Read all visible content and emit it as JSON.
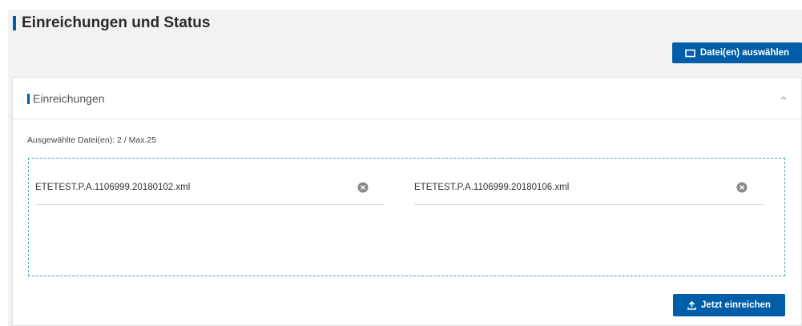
{
  "page": {
    "title": "Einreichungen und Status"
  },
  "toolbar": {
    "select_files_label": "Datei(en) auswählen",
    "select_files_icon": "folder-icon"
  },
  "card": {
    "title": "Einreichungen",
    "collapse_icon": "chevron-up-icon",
    "selected_count_label": "Ausgewählte Datei(en): 2 / Max.25",
    "files": [
      {
        "name": "ETETEST.P.A.1106999.20180102.xml"
      },
      {
        "name": "ETETEST.P.A.1106999.20180106.xml"
      }
    ],
    "remove_icon": "close-circle-icon",
    "submit_label": "Jetzt einreichen",
    "submit_icon": "upload-icon"
  },
  "colors": {
    "primary": "#005ea8",
    "background": "#f2f2f2",
    "dropzone_border": "#4aa3b8",
    "remove_icon": "#8a8a8a"
  }
}
